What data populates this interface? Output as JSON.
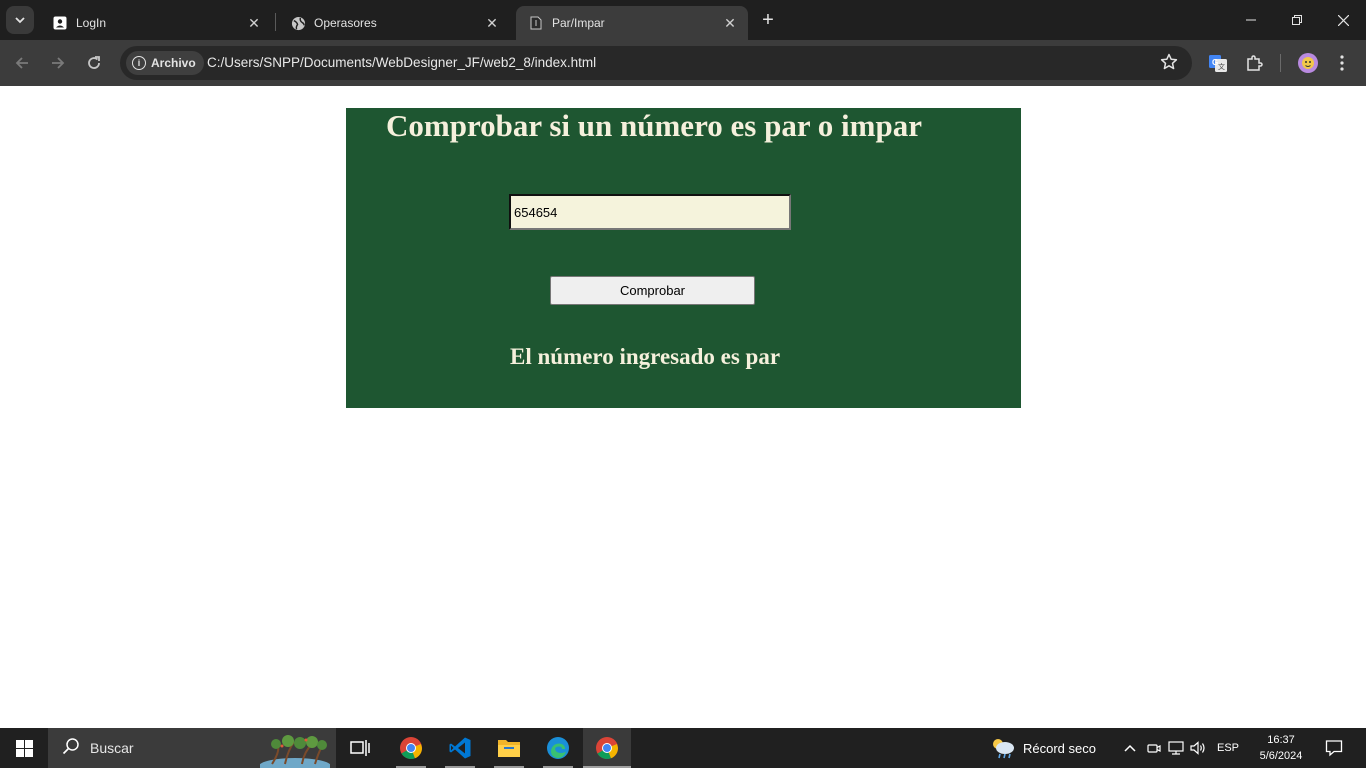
{
  "browser": {
    "tabs": [
      {
        "title": "LogIn",
        "favicon": "person-box-icon",
        "active": false
      },
      {
        "title": "Operasores",
        "favicon": "globe-icon",
        "active": false
      },
      {
        "title": "Par/Impar",
        "favicon": "file-icon",
        "active": true
      }
    ],
    "site_chip": "Archivo",
    "url": "C:/Users/SNPP/Documents/WebDesigner_JF/web2_8/index.html"
  },
  "page": {
    "heading": "Comprobar si un número es par o impar",
    "input_value": "654654",
    "button_label": "Comprobar",
    "result": "El número ingresado es par",
    "colors": {
      "panel_bg": "#1e5631",
      "text": "#f5f0dc",
      "input_bg": "#f5f3dc"
    }
  },
  "taskbar": {
    "search_label": "Buscar",
    "apps": [
      "task-view-icon",
      "chrome-icon",
      "vscode-icon",
      "file-explorer-icon",
      "edge-icon",
      "chrome-icon"
    ],
    "weather": "Récord seco",
    "language": "ESP",
    "time": "16:37",
    "date": "5/6/2024"
  }
}
